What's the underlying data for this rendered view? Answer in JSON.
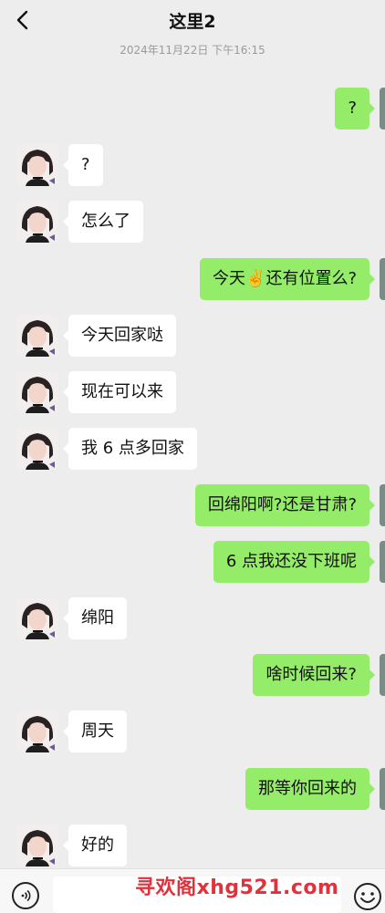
{
  "header": {
    "title": "这里2"
  },
  "timestamp": "2024年11月22日 下午16:15",
  "messages": [
    {
      "side": "right",
      "text": "?"
    },
    {
      "side": "left",
      "text": "?"
    },
    {
      "side": "left",
      "text": "怎么了"
    },
    {
      "side": "right",
      "text": "今天✌️还有位置么?"
    },
    {
      "side": "left",
      "text": "今天回家哒"
    },
    {
      "side": "left",
      "text": "现在可以来"
    },
    {
      "side": "left",
      "text": "我 6 点多回家"
    },
    {
      "side": "right",
      "text": "回绵阳啊?还是甘肃?"
    },
    {
      "side": "right",
      "text": "6 点我还没下班呢"
    },
    {
      "side": "left",
      "text": "绵阳"
    },
    {
      "side": "right",
      "text": "啥时候回来?"
    },
    {
      "side": "left",
      "text": "周天"
    },
    {
      "side": "right",
      "text": "那等你回来的"
    },
    {
      "side": "left",
      "text": "好的"
    }
  ],
  "bottom_bar": {
    "input_value": ""
  },
  "watermark": "寻欢阁xhg521.com",
  "colors": {
    "background": "#ededed",
    "outgoing_bubble": "#95ec69",
    "incoming_bubble": "#ffffff",
    "watermark": "#e0323c"
  },
  "icons": {
    "back": "chevron-left-icon",
    "voice": "voice-icon",
    "emoji": "emoji-icon"
  }
}
